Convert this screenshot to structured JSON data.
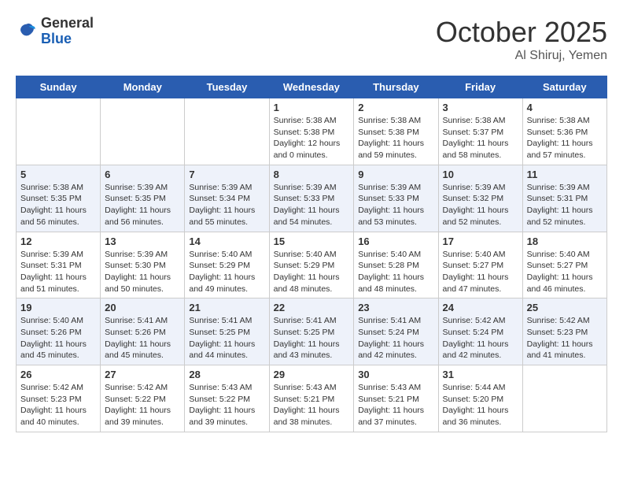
{
  "header": {
    "logo_general": "General",
    "logo_blue": "Blue",
    "month_title": "October 2025",
    "location": "Al Shiruj, Yemen"
  },
  "days_of_week": [
    "Sunday",
    "Monday",
    "Tuesday",
    "Wednesday",
    "Thursday",
    "Friday",
    "Saturday"
  ],
  "weeks": [
    [
      {
        "day": "",
        "info": ""
      },
      {
        "day": "",
        "info": ""
      },
      {
        "day": "",
        "info": ""
      },
      {
        "day": "1",
        "info": "Sunrise: 5:38 AM\nSunset: 5:38 PM\nDaylight: 12 hours and 0 minutes."
      },
      {
        "day": "2",
        "info": "Sunrise: 5:38 AM\nSunset: 5:38 PM\nDaylight: 11 hours and 59 minutes."
      },
      {
        "day": "3",
        "info": "Sunrise: 5:38 AM\nSunset: 5:37 PM\nDaylight: 11 hours and 58 minutes."
      },
      {
        "day": "4",
        "info": "Sunrise: 5:38 AM\nSunset: 5:36 PM\nDaylight: 11 hours and 57 minutes."
      }
    ],
    [
      {
        "day": "5",
        "info": "Sunrise: 5:38 AM\nSunset: 5:35 PM\nDaylight: 11 hours and 56 minutes."
      },
      {
        "day": "6",
        "info": "Sunrise: 5:39 AM\nSunset: 5:35 PM\nDaylight: 11 hours and 56 minutes."
      },
      {
        "day": "7",
        "info": "Sunrise: 5:39 AM\nSunset: 5:34 PM\nDaylight: 11 hours and 55 minutes."
      },
      {
        "day": "8",
        "info": "Sunrise: 5:39 AM\nSunset: 5:33 PM\nDaylight: 11 hours and 54 minutes."
      },
      {
        "day": "9",
        "info": "Sunrise: 5:39 AM\nSunset: 5:33 PM\nDaylight: 11 hours and 53 minutes."
      },
      {
        "day": "10",
        "info": "Sunrise: 5:39 AM\nSunset: 5:32 PM\nDaylight: 11 hours and 52 minutes."
      },
      {
        "day": "11",
        "info": "Sunrise: 5:39 AM\nSunset: 5:31 PM\nDaylight: 11 hours and 52 minutes."
      }
    ],
    [
      {
        "day": "12",
        "info": "Sunrise: 5:39 AM\nSunset: 5:31 PM\nDaylight: 11 hours and 51 minutes."
      },
      {
        "day": "13",
        "info": "Sunrise: 5:39 AM\nSunset: 5:30 PM\nDaylight: 11 hours and 50 minutes."
      },
      {
        "day": "14",
        "info": "Sunrise: 5:40 AM\nSunset: 5:29 PM\nDaylight: 11 hours and 49 minutes."
      },
      {
        "day": "15",
        "info": "Sunrise: 5:40 AM\nSunset: 5:29 PM\nDaylight: 11 hours and 48 minutes."
      },
      {
        "day": "16",
        "info": "Sunrise: 5:40 AM\nSunset: 5:28 PM\nDaylight: 11 hours and 48 minutes."
      },
      {
        "day": "17",
        "info": "Sunrise: 5:40 AM\nSunset: 5:27 PM\nDaylight: 11 hours and 47 minutes."
      },
      {
        "day": "18",
        "info": "Sunrise: 5:40 AM\nSunset: 5:27 PM\nDaylight: 11 hours and 46 minutes."
      }
    ],
    [
      {
        "day": "19",
        "info": "Sunrise: 5:40 AM\nSunset: 5:26 PM\nDaylight: 11 hours and 45 minutes."
      },
      {
        "day": "20",
        "info": "Sunrise: 5:41 AM\nSunset: 5:26 PM\nDaylight: 11 hours and 45 minutes."
      },
      {
        "day": "21",
        "info": "Sunrise: 5:41 AM\nSunset: 5:25 PM\nDaylight: 11 hours and 44 minutes."
      },
      {
        "day": "22",
        "info": "Sunrise: 5:41 AM\nSunset: 5:25 PM\nDaylight: 11 hours and 43 minutes."
      },
      {
        "day": "23",
        "info": "Sunrise: 5:41 AM\nSunset: 5:24 PM\nDaylight: 11 hours and 42 minutes."
      },
      {
        "day": "24",
        "info": "Sunrise: 5:42 AM\nSunset: 5:24 PM\nDaylight: 11 hours and 42 minutes."
      },
      {
        "day": "25",
        "info": "Sunrise: 5:42 AM\nSunset: 5:23 PM\nDaylight: 11 hours and 41 minutes."
      }
    ],
    [
      {
        "day": "26",
        "info": "Sunrise: 5:42 AM\nSunset: 5:23 PM\nDaylight: 11 hours and 40 minutes."
      },
      {
        "day": "27",
        "info": "Sunrise: 5:42 AM\nSunset: 5:22 PM\nDaylight: 11 hours and 39 minutes."
      },
      {
        "day": "28",
        "info": "Sunrise: 5:43 AM\nSunset: 5:22 PM\nDaylight: 11 hours and 39 minutes."
      },
      {
        "day": "29",
        "info": "Sunrise: 5:43 AM\nSunset: 5:21 PM\nDaylight: 11 hours and 38 minutes."
      },
      {
        "day": "30",
        "info": "Sunrise: 5:43 AM\nSunset: 5:21 PM\nDaylight: 11 hours and 37 minutes."
      },
      {
        "day": "31",
        "info": "Sunrise: 5:44 AM\nSunset: 5:20 PM\nDaylight: 11 hours and 36 minutes."
      },
      {
        "day": "",
        "info": ""
      }
    ]
  ]
}
